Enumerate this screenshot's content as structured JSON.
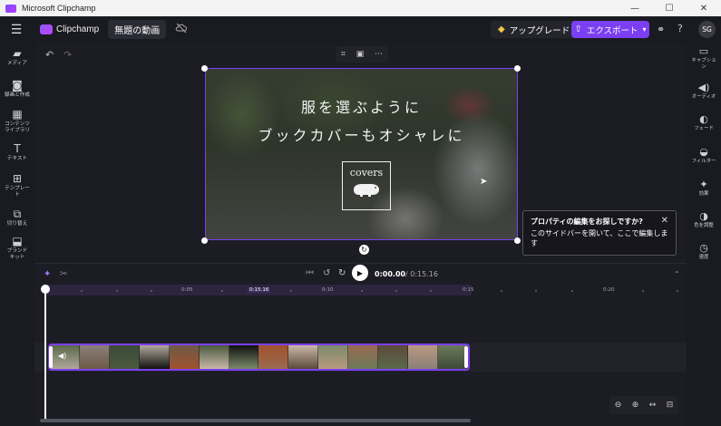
{
  "window": {
    "title": "Microsoft Clipchamp",
    "controls": [
      "—",
      "☐",
      "✕"
    ]
  },
  "appbar": {
    "brand": "Clipchamp",
    "project_name": "無題の動画",
    "upgrade_label": "アップグレード",
    "export_label": "エクスポート",
    "avatar_initials": "SG"
  },
  "left_sidebar": [
    {
      "label": "メディア",
      "icon": "folder-icon"
    },
    {
      "label": "録画と作成",
      "icon": "camera-icon"
    },
    {
      "label": "コンテンツ\nライブラリ",
      "icon": "library-icon"
    },
    {
      "label": "テキスト",
      "icon": "text-icon"
    },
    {
      "label": "テンプレー\nト",
      "icon": "templates-icon"
    },
    {
      "label": "切り替え",
      "icon": "transitions-icon"
    },
    {
      "label": "ブランド\nキット",
      "icon": "brand-kit-icon"
    }
  ],
  "right_sidebar": [
    {
      "label": "キャプショ\nン",
      "icon": "captions-icon"
    },
    {
      "label": "オーディオ",
      "icon": "audio-icon"
    },
    {
      "label": "フェード",
      "icon": "fade-icon"
    },
    {
      "label": "フィルター",
      "icon": "filter-icon"
    },
    {
      "label": "効果",
      "icon": "effects-icon"
    },
    {
      "label": "色を調整",
      "icon": "color-adjust-icon"
    },
    {
      "label": "速度",
      "icon": "speed-icon"
    }
  ],
  "preview": {
    "line1": "服を選ぶように",
    "line2": "ブックカバーもオシャレに",
    "logo_text": "covers"
  },
  "tooltip": {
    "title": "プロパティの編集をお探しですか?",
    "body": "このサイドバーを開いて、ここで編集します"
  },
  "timeline": {
    "current_time": "0:00.00",
    "total_time": "/ 0:15.16",
    "ruler_labels": [
      "0:05",
      "0:15.16",
      "0:10",
      "0:15",
      "0:20"
    ],
    "clip_thumbnail_count": 14
  },
  "colors": {
    "accent": "#7b3ff2",
    "background": "#1c1c24",
    "sidebar": "#1a1a21"
  }
}
